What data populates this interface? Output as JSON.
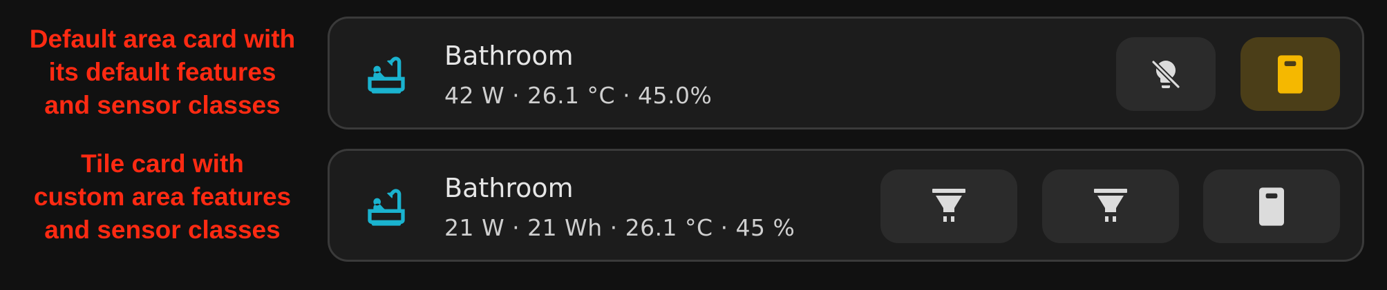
{
  "annotations": {
    "first": [
      "Default area card with",
      "its default features",
      "and sensor classes"
    ],
    "second": [
      "Tile card with",
      "custom area features",
      "and sensor classes"
    ]
  },
  "cards": [
    {
      "title": "Bathroom",
      "state": "42 W · 26.1 °C · 45.0%",
      "icon": "bathtub-icon",
      "features": [
        {
          "name": "lights-off-toggle",
          "icon": "lightbulb-off-icon",
          "active": false
        },
        {
          "name": "door-sensor",
          "icon": "door-icon",
          "active": true
        }
      ]
    },
    {
      "title": "Bathroom",
      "state": "21 W · 21 Wh · 26.1 °C · 45 %",
      "icon": "bathtub-icon",
      "features": [
        {
          "name": "spotlight-1",
          "icon": "spotlight-icon",
          "active": false
        },
        {
          "name": "spotlight-2",
          "icon": "spotlight-icon",
          "active": false
        },
        {
          "name": "door-sensor",
          "icon": "door-icon",
          "active": false
        }
      ]
    }
  ],
  "colors": {
    "background": "#111111",
    "card": "#1c1c1c",
    "card_border": "#3a3a3a",
    "annotation": "#ff2a12",
    "area_icon": "#1ab3cf",
    "active_feature_bg": "#4b3e18",
    "active_door": "#f5b800",
    "inactive_icon": "#dcdcdc"
  }
}
